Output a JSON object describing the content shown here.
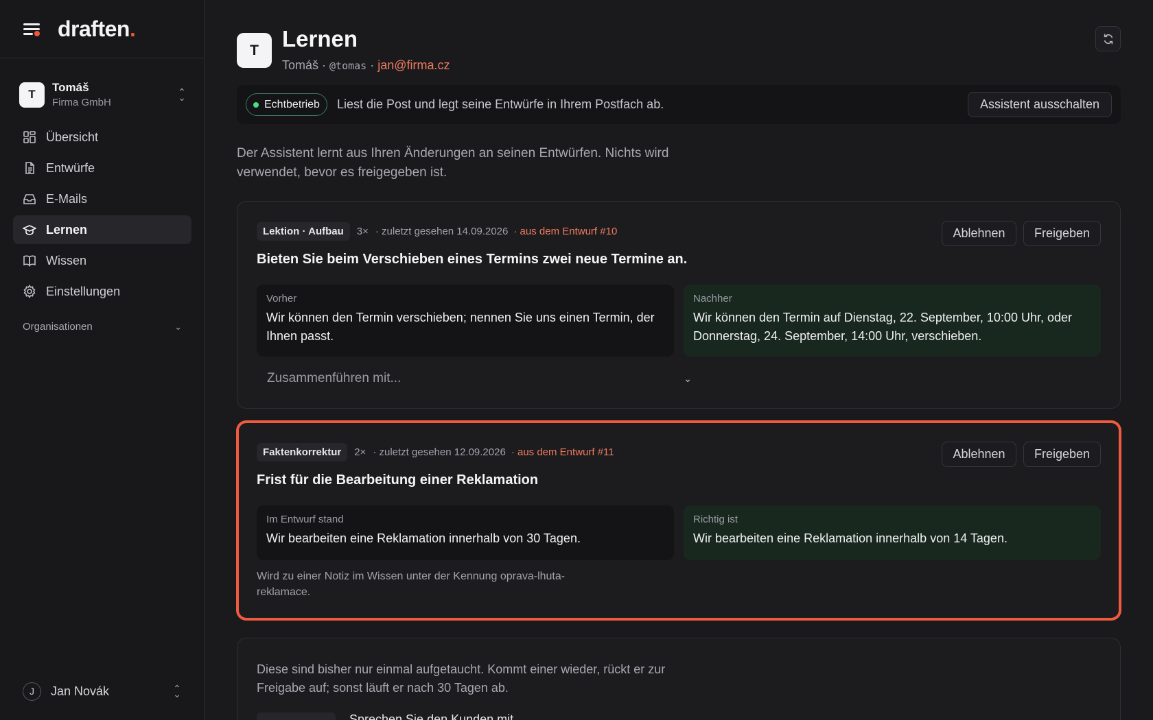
{
  "app": {
    "logo": "draften",
    "logo_dot": "."
  },
  "workspace": {
    "avatar": "T",
    "name": "Tomáš",
    "org": "Firma GmbH"
  },
  "nav": {
    "items": [
      {
        "label": "Übersicht",
        "icon": "dashboard-icon"
      },
      {
        "label": "Entwürfe",
        "icon": "document-icon"
      },
      {
        "label": "E-Mails",
        "icon": "inbox-icon"
      },
      {
        "label": "Lernen",
        "icon": "graduation-cap-icon",
        "active": true
      },
      {
        "label": "Wissen",
        "icon": "book-icon"
      },
      {
        "label": "Einstellungen",
        "icon": "gear-icon"
      }
    ],
    "orgs_label": "Organisationen"
  },
  "user": {
    "avatar": "J",
    "name": "Jan Novák"
  },
  "page": {
    "avatar": "T",
    "title": "Lernen",
    "sub_name": "Tomáš ·",
    "sub_handle": "@tomas",
    "sub_sep": "·",
    "sub_email": "jan@firma.cz"
  },
  "status": {
    "badge": "Echtbetrieb",
    "text": "Liest die Post und legt seine Entwürfe in Ihrem Postfach ab.",
    "button": "Assistent ausschalten",
    "color": "#4ade80"
  },
  "intro": "Der Assistent lernt aus Ihren Änderungen an seinen Entwürfen. Nichts wird verwendet, bevor es freigegeben ist.",
  "cards": [
    {
      "tag": "Lektion · Aufbau",
      "count": "3×",
      "seen": "· zuletzt gesehen 14.09.2026",
      "source": "· aus dem Entwurf #10",
      "reject": "Ablehnen",
      "approve": "Freigeben",
      "title": "Bieten Sie beim Verschieben eines Termins zwei neue Termine an.",
      "left_label": "Vorher",
      "left_text": "Wir können den Termin verschieben; nennen Sie uns einen Termin, der Ihnen passt.",
      "right_label": "Nachher",
      "right_text": "Wir können den Termin auf Dienstag, 22. September, 10:00 Uhr, oder Donnerstag, 24. September, 14:00 Uhr, verschieben.",
      "merge_placeholder": "Zusammenführen mit..."
    },
    {
      "tag": "Faktenkorrektur",
      "count": "2×",
      "seen": "· zuletzt gesehen 12.09.2026",
      "source": "· aus dem Entwurf #11",
      "reject": "Ablehnen",
      "approve": "Freigeben",
      "title": "Frist für die Bearbeitung einer Reklamation",
      "left_label": "Im Entwurf stand",
      "left_text": "Wir bearbeiten eine Reklamation innerhalb von 30 Tagen.",
      "right_label": "Richtig ist",
      "right_text": "Wir bearbeiten eine Reklamation innerhalb von 14 Tagen.",
      "note": "Wird zu einer Notiz im Wissen unter der Kennung oprava-lhuta-reklamace."
    }
  ],
  "pending": {
    "text": "Diese sind bisher nur einmal aufgetaucht. Kommt einer wieder, rückt er zur Freigabe auf; sonst läuft er nach 30 Tagen ab.",
    "row_text": "Sprechen Sie den Kunden mit"
  },
  "colors": {
    "accent": "#f0573c",
    "highlight_border": "#f05a3f",
    "link": "#f07a5e"
  }
}
